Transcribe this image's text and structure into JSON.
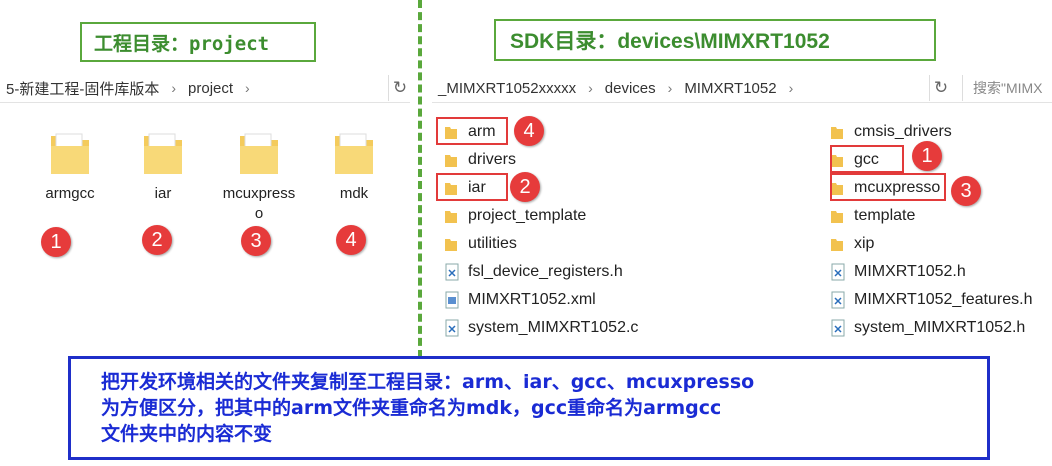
{
  "left": {
    "label": "工程目录：project",
    "breadcrumb": [
      "5-新建工程-固件库版本",
      "project"
    ],
    "folders": [
      {
        "name": "armgcc",
        "badge": "1"
      },
      {
        "name": "iar",
        "badge": "2"
      },
      {
        "name": "mcuxpresso",
        "badge": "3"
      },
      {
        "name": "mdk",
        "badge": "4"
      }
    ]
  },
  "right": {
    "label": "SDK目录：devices\\MIMXRT1052",
    "breadcrumb": [
      "_MIMXRT1052xxxxx",
      "devices",
      "MIMXRT1052"
    ],
    "search_placeholder": "搜索\"MIMX",
    "col1": [
      "arm",
      "drivers",
      "iar",
      "project_template",
      "utilities",
      "fsl_device_registers.h",
      "MIMXRT1052.xml",
      "system_MIMXRT1052.c"
    ],
    "col2": [
      "cmsis_drivers",
      "gcc",
      "mcuxpresso",
      "template",
      "xip",
      "MIMXRT1052.h",
      "MIMXRT1052_features.h",
      "system_MIMXRT1052.h"
    ],
    "badges": {
      "arm": "4",
      "gcc": "1",
      "iar": "2",
      "mcuxpresso": "3"
    }
  },
  "note": {
    "line1": "把开发环境相关的文件夹复制至工程目录：arm、iar、gcc、mcuxpresso",
    "line2": "为方便区分，把其中的arm文件夹重命名为mdk，gcc重命名为armgcc",
    "line3": "文件夹中的内容不变"
  },
  "colors": {
    "green": "#5aa83c",
    "red": "#e63b3b",
    "blue": "#1a2bd4"
  },
  "icons": [
    "folder-icon",
    "refresh-icon",
    "chevron-right-icon",
    "header-file-icon",
    "xml-file-icon",
    "c-file-icon"
  ]
}
